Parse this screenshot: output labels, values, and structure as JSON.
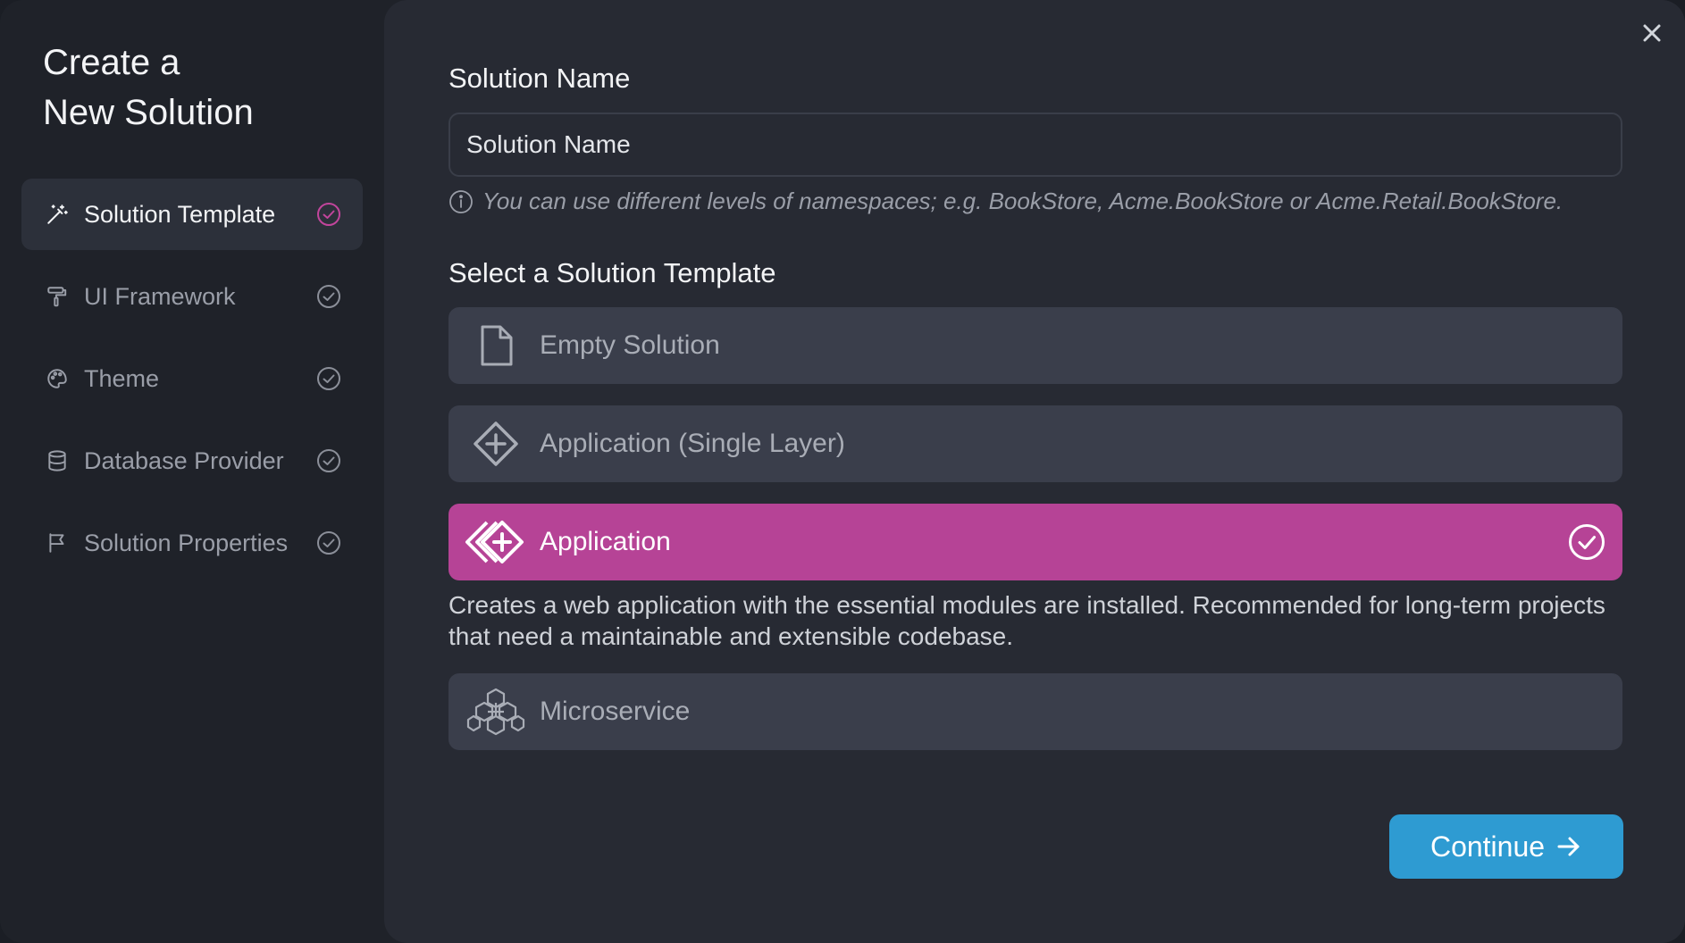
{
  "sidebar": {
    "title": "Create a\nNew Solution",
    "steps": [
      {
        "label": "Solution Template",
        "icon": "magic-wand-icon",
        "active": true
      },
      {
        "label": "UI Framework",
        "icon": "paint-roller-icon",
        "active": false
      },
      {
        "label": "Theme",
        "icon": "palette-icon",
        "active": false
      },
      {
        "label": "Database Provider",
        "icon": "database-icon",
        "active": false
      },
      {
        "label": "Solution Properties",
        "icon": "flag-icon",
        "active": false
      }
    ]
  },
  "main": {
    "solution_name_label": "Solution Name",
    "solution_name_placeholder": "Solution Name",
    "hint": "You can use different levels of namespaces; e.g. BookStore, Acme.BookStore or Acme.Retail.BookStore.",
    "template_label": "Select a Solution Template",
    "templates": [
      {
        "label": "Empty Solution",
        "icon": "file-icon",
        "selected": false
      },
      {
        "label": "Application (Single Layer)",
        "icon": "diamond-plus-icon",
        "selected": false
      },
      {
        "label": "Application",
        "icon": "double-diamond-plus-icon",
        "selected": true
      },
      {
        "label": "Microservice",
        "icon": "hexagon-cluster-icon",
        "selected": false
      }
    ],
    "selected_description": "Creates a web application with the essential modules are installed. Recommended for long-term projects that need a maintainable and extensible codebase.",
    "continue_label": "Continue"
  },
  "colors": {
    "accent": "#b64396",
    "primary_button": "#2e9bd2",
    "sidebar_bg": "#1f2229",
    "main_bg": "#272a33",
    "card_bg": "#3a3e4b"
  }
}
